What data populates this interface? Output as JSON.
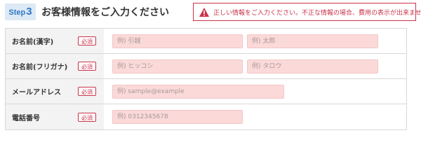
{
  "header": {
    "step_word": "Step",
    "step_number": "3",
    "title": "お客様情報をご入力ください"
  },
  "alert": {
    "text": "正しい情報をご入力ください。不正な情報の場合、費用の表示が出来ません。",
    "color": "#c8344a"
  },
  "required_label": "必須",
  "rows": [
    {
      "label": "お名前(漢字)",
      "placeholders": [
        "例) 引越",
        "例) 太郎"
      ]
    },
    {
      "label": "お名前(フリガナ)",
      "placeholders": [
        "例) ヒッコシ",
        "例) タロウ"
      ]
    },
    {
      "label": "メールアドレス",
      "placeholders": [
        "例) sample@example"
      ]
    },
    {
      "label": "電話番号",
      "placeholders": [
        "例) 0312345678"
      ]
    }
  ],
  "colors": {
    "accent_blue": "#2f78c4",
    "badge_bg": "#dde9f5",
    "field_bg": "#fbd9d9",
    "label_bg": "#f3f3f3"
  }
}
